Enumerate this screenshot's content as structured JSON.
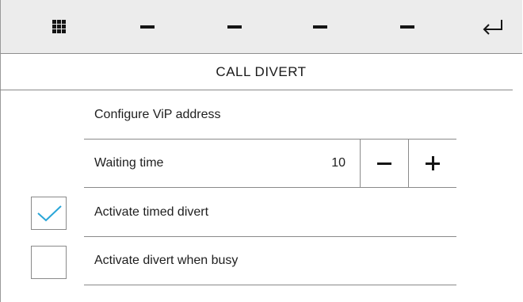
{
  "toolbar": {
    "menu_icon": "grid-icon",
    "slots": [
      "dash-icon",
      "dash-icon",
      "dash-icon",
      "dash-icon"
    ],
    "back_icon": "return-arrow-icon"
  },
  "page": {
    "title": "CALL DIVERT"
  },
  "settings": {
    "configure_vip": {
      "label": "Configure ViP address"
    },
    "waiting_time": {
      "label": "Waiting time",
      "value": "10"
    },
    "timed_divert": {
      "label": "Activate timed divert",
      "checked": true
    },
    "divert_busy": {
      "label": "Activate divert when busy",
      "checked": false
    }
  },
  "colors": {
    "check_accent": "#2aa6d8",
    "toolbar_bg": "#ececec"
  }
}
